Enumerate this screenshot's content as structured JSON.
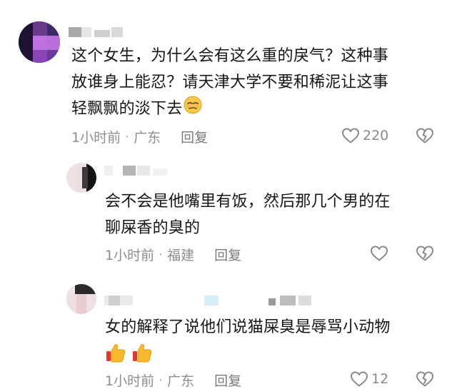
{
  "comments": [
    {
      "lines": [
        "这个女生，为什么会有这么重的戾气？这种事",
        "放谁身上能忍？请天津大学不要和稀泥让这事",
        "轻飘飘的淡下去"
      ],
      "time": "1小时前",
      "location": "广东",
      "reply_label": "回复",
      "like_count": "220",
      "emoji": "smirk-face-emoji"
    },
    {
      "lines": [
        "会不会是他嘴里有饭，然后那几个男的在",
        "聊屎香的臭的"
      ],
      "time": "1小时前",
      "location": "福建",
      "reply_label": "回复",
      "like_count": ""
    },
    {
      "lines": [
        "女的解释了说他们说猫屎臭是辱骂小动物"
      ],
      "time": "1小时前",
      "location": "广东",
      "reply_label": "回复",
      "like_count": "12",
      "emoji": "thumbs-up-emoji"
    }
  ],
  "icons": {
    "like": "heart-outline-icon",
    "dislike": "broken-heart-icon"
  },
  "colors": {
    "text": "#161616",
    "meta": "#8e8e8e",
    "icon": "#8a8a8a"
  }
}
